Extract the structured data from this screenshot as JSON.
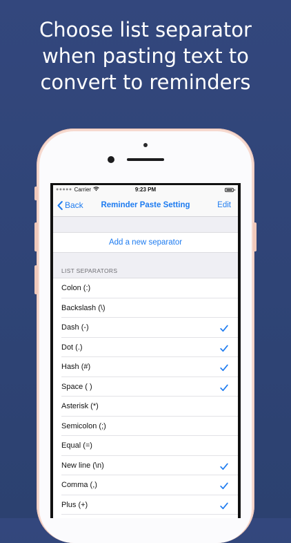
{
  "headline": {
    "line1": "Choose list separator",
    "line2": "when pasting text to",
    "line3": "convert to reminders"
  },
  "status_bar": {
    "carrier": "Carrier",
    "time": "9:23 PM",
    "signal_icon": "signal-dots-icon",
    "wifi_icon": "wifi-icon",
    "battery_icon": "battery-icon"
  },
  "nav": {
    "back_label": "Back",
    "title": "Reminder Paste Setting",
    "edit_label": "Edit"
  },
  "add_separator_label": "Add a new separator",
  "section_header": "LIST SEPARATORS",
  "separators": [
    {
      "label": "Colon (:)",
      "checked": false
    },
    {
      "label": "Backslash (\\)",
      "checked": false
    },
    {
      "label": "Dash (-)",
      "checked": true
    },
    {
      "label": "Dot (.)",
      "checked": true
    },
    {
      "label": "Hash (#)",
      "checked": true
    },
    {
      "label": "Space ( )",
      "checked": true
    },
    {
      "label": "Asterisk (*)",
      "checked": false
    },
    {
      "label": "Semicolon (;)",
      "checked": false
    },
    {
      "label": "Equal (=)",
      "checked": false
    },
    {
      "label": "New line (\\n)",
      "checked": true
    },
    {
      "label": "Comma (,)",
      "checked": true
    },
    {
      "label": "Plus (+)",
      "checked": true
    }
  ],
  "colors": {
    "accent": "#1d7bf0",
    "background_top": "#33477d",
    "phone_frame": "#f6d9cf"
  }
}
